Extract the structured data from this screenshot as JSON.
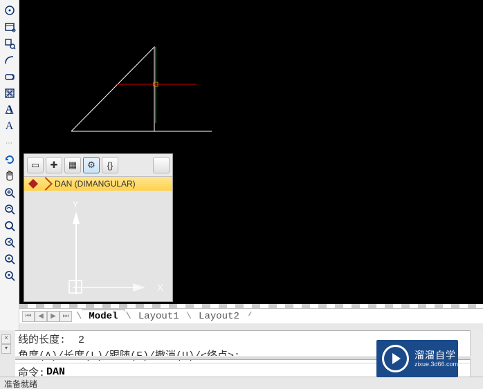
{
  "toolbar_left": {
    "items": [
      {
        "name": "target-icon"
      },
      {
        "name": "window-icon"
      },
      {
        "name": "zoom-window-icon"
      },
      {
        "name": "arc-icon"
      },
      {
        "name": "erase-icon"
      },
      {
        "name": "hatch-icon"
      },
      {
        "name": "text-bold-icon"
      },
      {
        "name": "text-normal-icon"
      },
      {
        "name": "refresh-icon"
      },
      {
        "name": "pan-hand-icon"
      },
      {
        "name": "zoom-extents-icon"
      },
      {
        "name": "zoom-realtime-icon"
      },
      {
        "name": "zoom-in-icon"
      },
      {
        "name": "zoom-previous-icon"
      },
      {
        "name": "zoom-all-icon"
      },
      {
        "name": "zoom-center-icon"
      }
    ]
  },
  "autocomplete": {
    "item_label": "DAN (DIMANGULAR)",
    "toolbar": [
      {
        "name": "ac-view-btn",
        "glyph": "▭"
      },
      {
        "name": "ac-plus-btn",
        "glyph": "✚"
      },
      {
        "name": "ac-layer-btn",
        "glyph": "▦"
      },
      {
        "name": "ac-gear-btn",
        "glyph": "⚙"
      },
      {
        "name": "ac-braces-btn",
        "glyph": "{}"
      },
      {
        "name": "ac-blank-btn",
        "glyph": ""
      }
    ]
  },
  "tabs": {
    "nav": {
      "first": "⏮",
      "prev": "◀",
      "next": "▶",
      "last": "⏭"
    },
    "items": [
      {
        "label": "Model",
        "active": true
      },
      {
        "label": "Layout1",
        "active": false
      },
      {
        "label": "Layout2",
        "active": false
      }
    ]
  },
  "command_history": [
    "线的长度:  2",
    "角度(A)/长度(L)/跟随(F)/撤消(U)/<终点>:"
  ],
  "command_prompt": "命令:  ",
  "command_value": "DAN",
  "status_text": "准备就绪",
  "watermark": {
    "title": "溜溜自学",
    "sub": "zixue.3d66.com"
  }
}
